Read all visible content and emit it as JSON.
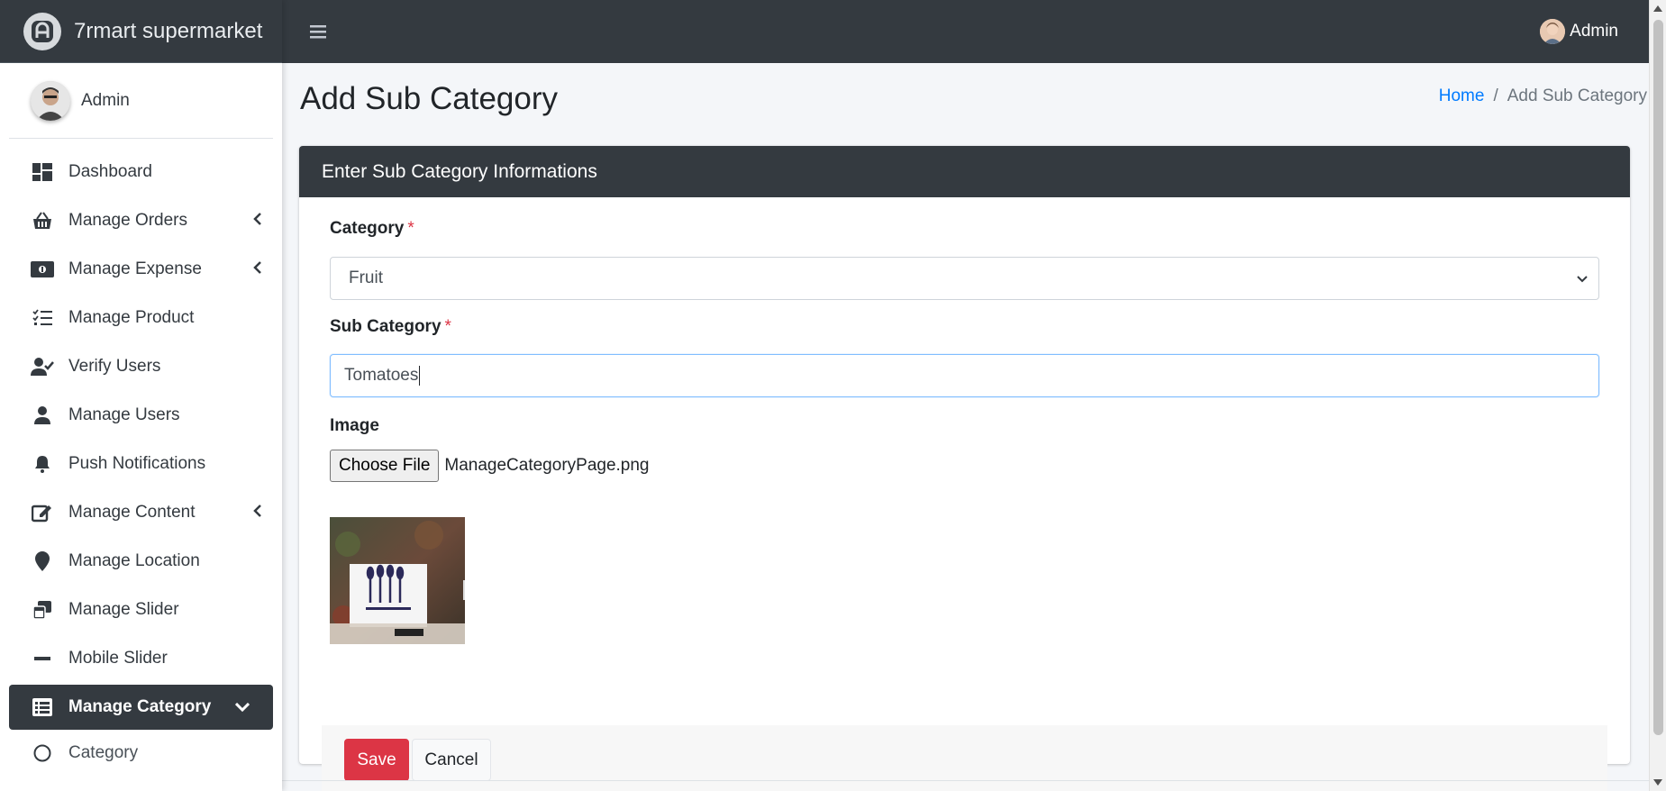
{
  "brand": {
    "name": "7rmart supermarket"
  },
  "user": {
    "name": "Admin"
  },
  "topbar": {
    "user_name": "Admin"
  },
  "sidebar": {
    "items": [
      {
        "label": "Dashboard",
        "icon": "dashboard-icon"
      },
      {
        "label": "Manage Orders",
        "icon": "basket-icon"
      },
      {
        "label": "Manage Expense",
        "icon": "money-icon"
      },
      {
        "label": "Manage Product",
        "icon": "checklist-icon"
      },
      {
        "label": "Verify Users",
        "icon": "user-check-icon"
      },
      {
        "label": "Manage Users",
        "icon": "user-icon"
      },
      {
        "label": "Push Notifications",
        "icon": "bell-icon"
      },
      {
        "label": "Manage Content",
        "icon": "edit-icon"
      },
      {
        "label": "Manage Location",
        "icon": "map-marker-icon"
      },
      {
        "label": "Manage Slider",
        "icon": "window-restore-icon"
      },
      {
        "label": "Mobile Slider",
        "icon": "minus-icon"
      },
      {
        "label": "Manage Category",
        "icon": "list-icon"
      },
      {
        "label": "Category",
        "icon": "circle-icon"
      }
    ]
  },
  "page": {
    "title": "Add Sub Category",
    "breadcrumb": {
      "home": "Home",
      "separator": "/",
      "current": "Add Sub Category"
    }
  },
  "form": {
    "header": "Enter Sub Category Informations",
    "category_label": "Category",
    "category_value": "Fruit",
    "subcategory_label": "Sub Category",
    "subcategory_value": "Tomatoes",
    "image_label": "Image",
    "file_button": "Choose File",
    "file_name": "ManageCategoryPage.png",
    "required_mark": "*",
    "save": "Save",
    "cancel": "Cancel"
  },
  "colors": {
    "dark": "#343a40",
    "link": "#007bff",
    "danger": "#dc3545"
  }
}
